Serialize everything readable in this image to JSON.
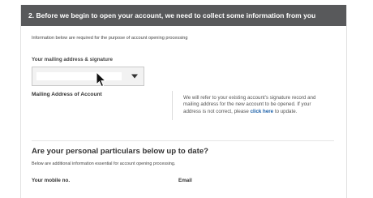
{
  "header": {
    "title": "2. Before we begin to open your account, we need to collect some information from you"
  },
  "intro_text": "Information below are required for the purpose of account opening processing",
  "address_select": {
    "label": "Your mailing address & signature",
    "value": ""
  },
  "mailing_address_label": "Mailing Address of Account",
  "note": {
    "text": "We will refer to your existing account's signature record and mailing address for the new account to be opened. If your address is not correct, please",
    "link": "click here",
    "suffix": "to update."
  },
  "particulars": {
    "title": "Are your personal particulars below up to date?",
    "description": "Below are additional information essential for account opening processing.",
    "mobile_label": "Your mobile no.",
    "email_label": "Email"
  },
  "colors": {
    "header_bg": "#58595b",
    "link": "#1a5fa8"
  }
}
